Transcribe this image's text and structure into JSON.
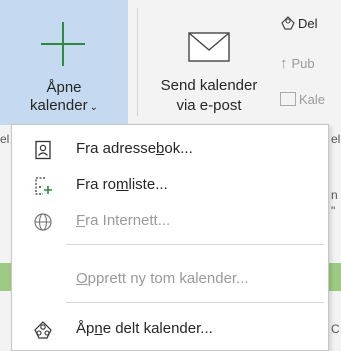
{
  "ribbon": {
    "open_calendar": {
      "line1": "Åpne",
      "line2": "kalender",
      "chevron": "⌄"
    },
    "send_calendar": {
      "line1": "Send kalender",
      "line2": "via e-post"
    },
    "share": {
      "label": "Del"
    },
    "publish": {
      "label": "Pub"
    },
    "calendar_perm": {
      "label": "Kale"
    }
  },
  "background_fragments": {
    "left_el": "el",
    "right_el": "el",
    "right_n": "n",
    "right_comma": "\"",
    "right_c": "C"
  },
  "menu": {
    "items": [
      {
        "pre": "Fra adresse",
        "u": "b",
        "post": "ok...",
        "icon": "address-book-icon",
        "enabled": true
      },
      {
        "pre": "Fra ro",
        "u": "m",
        "post": "liste...",
        "icon": "room-list-icon",
        "enabled": true
      },
      {
        "pre": "",
        "u": "F",
        "post": "ra Internett...",
        "icon": "globe-icon",
        "enabled": false
      },
      {
        "pre": "",
        "u": "O",
        "post": "pprett ny tom kalender...",
        "icon": "",
        "enabled": false
      },
      {
        "pre": "Åp",
        "u": "n",
        "post": "e delt kalender...",
        "icon": "shared-calendar-icon",
        "enabled": true
      }
    ]
  },
  "colors": {
    "accent_green": "#2d8a3e",
    "selected_bg": "#c5daf0",
    "disabled_text": "#9a9a9a"
  }
}
